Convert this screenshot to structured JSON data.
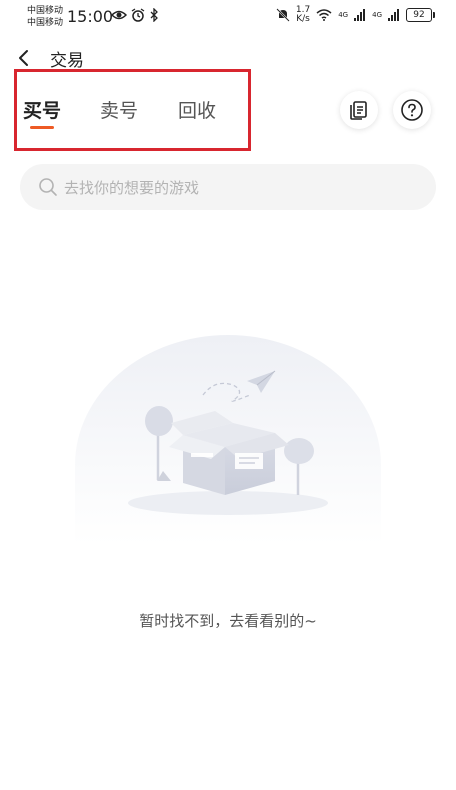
{
  "status_bar": {
    "carrier1": "中国移动",
    "carrier2": "中国移动",
    "time": "15:00",
    "speed_value": "1.7",
    "speed_unit": "K/s",
    "network1": "4G",
    "network2": "4G",
    "battery": "92"
  },
  "nav": {
    "title": "交易"
  },
  "tabs": [
    {
      "label": "买号",
      "active": true
    },
    {
      "label": "卖号",
      "active": false
    },
    {
      "label": "回收",
      "active": false
    }
  ],
  "accent_color": "#ee5a24",
  "highlight_color": "#d8262f",
  "search": {
    "placeholder": "去找你的想要的游戏"
  },
  "empty_state": {
    "message": "暂时找不到，去看看别的~"
  }
}
